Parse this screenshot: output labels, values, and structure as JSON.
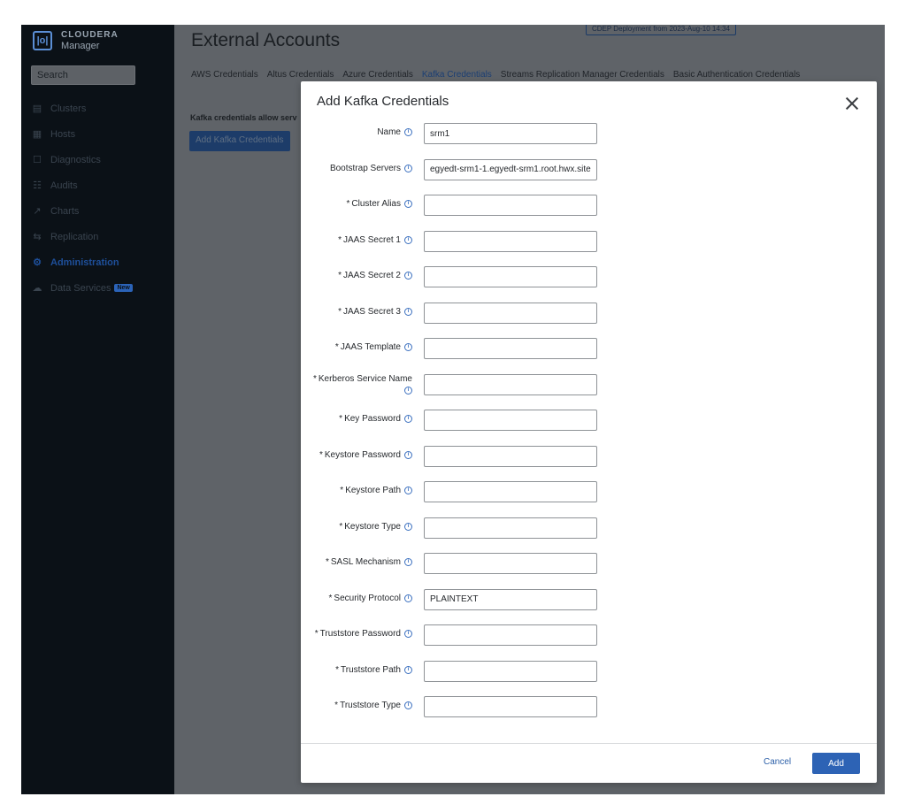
{
  "brand": {
    "name": "CLOUDERA",
    "product": "Manager"
  },
  "sidebar": {
    "search_placeholder": "Search",
    "items": [
      {
        "label": "Clusters",
        "icon": "clusters-icon"
      },
      {
        "label": "Hosts",
        "icon": "hosts-icon"
      },
      {
        "label": "Diagnostics",
        "icon": "diagnostics-icon"
      },
      {
        "label": "Audits",
        "icon": "audits-icon"
      },
      {
        "label": "Charts",
        "icon": "charts-icon"
      },
      {
        "label": "Replication",
        "icon": "replication-icon"
      },
      {
        "label": "Administration",
        "icon": "gear-icon",
        "active": true
      },
      {
        "label": "Data Services",
        "icon": "cloud-icon",
        "badge": "New"
      }
    ]
  },
  "main": {
    "title": "External Accounts",
    "deployment_badge": "CDEP Deployment from 2023-Aug-10 14:34",
    "tabs": [
      {
        "label": "AWS Credentials"
      },
      {
        "label": "Altus Credentials"
      },
      {
        "label": "Azure Credentials"
      },
      {
        "label": "Kafka Credentials",
        "active": true
      },
      {
        "label": "Streams Replication Manager Credentials"
      },
      {
        "label": "Basic Authentication Credentials"
      }
    ],
    "description": "Kafka credentials allow serv",
    "add_button": "Add Kafka Credentials"
  },
  "modal": {
    "title": "Add Kafka Credentials",
    "fields": [
      {
        "label": "Name",
        "required": false,
        "value": "srm1"
      },
      {
        "label": "Bootstrap Servers",
        "required": false,
        "value": "egyedt-srm1-1.egyedt-srm1.root.hwx.site"
      },
      {
        "label": "Cluster Alias",
        "required": true,
        "value": ""
      },
      {
        "label": "JAAS Secret 1",
        "required": true,
        "value": ""
      },
      {
        "label": "JAAS Secret 2",
        "required": true,
        "value": ""
      },
      {
        "label": "JAAS Secret 3",
        "required": true,
        "value": ""
      },
      {
        "label": "JAAS Template",
        "required": true,
        "value": ""
      },
      {
        "label": "Kerberos Service Name",
        "required": true,
        "value": "",
        "two_line": true
      },
      {
        "label": "Key Password",
        "required": true,
        "value": ""
      },
      {
        "label": "Keystore Password",
        "required": true,
        "value": ""
      },
      {
        "label": "Keystore Path",
        "required": true,
        "value": ""
      },
      {
        "label": "Keystore Type",
        "required": true,
        "value": ""
      },
      {
        "label": "SASL Mechanism",
        "required": true,
        "value": ""
      },
      {
        "label": "Security Protocol",
        "required": true,
        "value": "PLAINTEXT"
      },
      {
        "label": "Truststore Password",
        "required": true,
        "value": ""
      },
      {
        "label": "Truststore Path",
        "required": true,
        "value": ""
      },
      {
        "label": "Truststore Type",
        "required": true,
        "value": ""
      }
    ],
    "cancel_label": "Cancel",
    "add_label": "Add"
  },
  "colors": {
    "sidebar_bg": "#0b1117",
    "overlay": "#5f6368",
    "primary": "#2d63b5",
    "active_nav": "#1e4f9a"
  }
}
